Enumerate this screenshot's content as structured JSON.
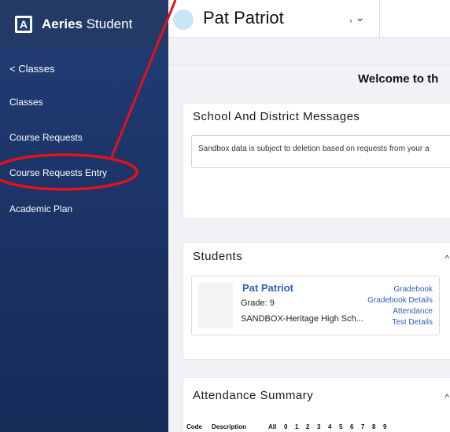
{
  "brand": {
    "bold": "Aeries",
    "rest": " Student",
    "logo_letter": "A"
  },
  "sidebar": {
    "back_label": "< Classes",
    "items": [
      {
        "label": "Classes"
      },
      {
        "label": "Course Requests"
      },
      {
        "label": "Course Requests Entry"
      },
      {
        "label": "Academic Plan"
      }
    ]
  },
  "header": {
    "student_name": "Pat Patriot",
    "dropdown": ", ⌄"
  },
  "main": {
    "welcome": "Welcome to th",
    "messages": {
      "title": "School And District Messages",
      "text": "Sandbox data is subject to deletion based on requests from your a"
    },
    "students": {
      "title": "Students",
      "caret": "^",
      "card": {
        "name": "Pat Patriot",
        "grade_label": "Grade:",
        "grade_value": "9",
        "school": "SANDBOX-Heritage High Sch...",
        "links": [
          "Gradebook",
          "Gradebook Details",
          "Attendance",
          "Test Details"
        ]
      }
    },
    "attendance": {
      "title": "Attendance Summary",
      "caret": "^",
      "columns": [
        "Code",
        "Description",
        "All",
        "0",
        "1",
        "2",
        "3",
        "4",
        "5",
        "6",
        "7",
        "8",
        "9"
      ]
    }
  },
  "colors": {
    "sidebar": "#1c3467",
    "link": "#2f5fb8",
    "annotation": "#e3121b"
  }
}
